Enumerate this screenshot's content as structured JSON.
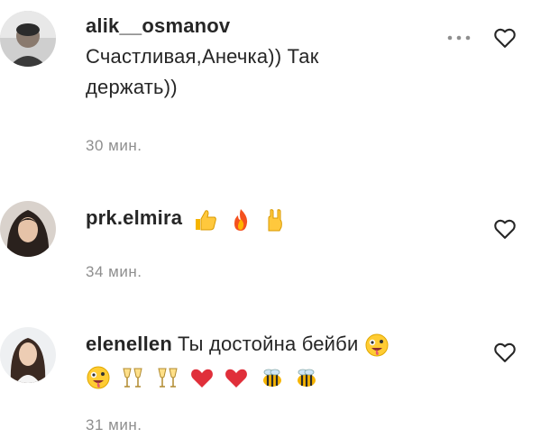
{
  "comments": [
    {
      "username": "alik__osmanov",
      "text_lines": [
        "Счастливая,Анечка)) Так",
        "держать))"
      ],
      "time": "30 мин.",
      "emojis": []
    },
    {
      "username": "prk.elmira",
      "text": "",
      "emojis": [
        "thumbs-up",
        "fire",
        "horns"
      ],
      "time": "34 мин."
    },
    {
      "username": "elenellen",
      "text": "Ты достойна бейби",
      "emojis_inline": [
        "zany-face"
      ],
      "emojis_line2": [
        "zany-face",
        "clinking-glasses",
        "clinking-glasses",
        "heart-exclamation",
        "heart-exclamation",
        "bee",
        "bee"
      ],
      "time": "31 мин."
    }
  ],
  "icons": {
    "more": "more-horizontal-icon",
    "like": "heart-outline-icon"
  },
  "colors": {
    "text": "#262626",
    "secondary": "#8e8e8e"
  }
}
